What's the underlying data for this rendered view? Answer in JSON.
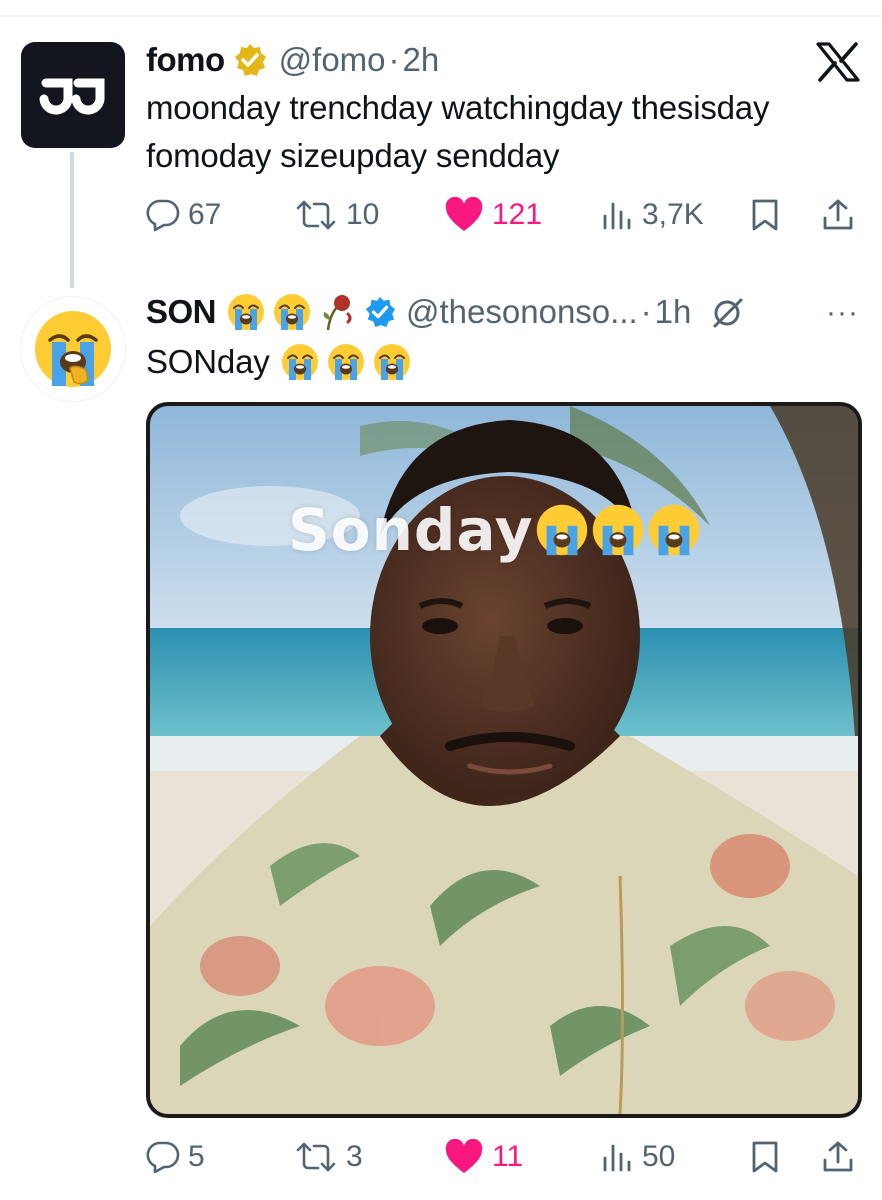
{
  "thread": [
    {
      "name": "fomo",
      "handle": "@fomo",
      "dot": "·",
      "time": "2h",
      "text_line1": "moonday trenchday watchingday thesisday",
      "text_line2": "fomoday sizeupday sendday",
      "replies": "67",
      "reposts": "10",
      "likes": "121",
      "views": "3,7K",
      "verified_color": "#e2b719",
      "avatar_icon": "fomo-logo-icon"
    },
    {
      "name": "SON",
      "handle": "@thesononso...",
      "dot": "·",
      "time": "1h",
      "text": "SONday",
      "more": "···",
      "media_caption": "Sonday",
      "replies": "5",
      "reposts": "3",
      "likes": "11",
      "views": "50",
      "verified_color": "#1d9bf0",
      "avatar_icon": "loudly-crying-face-icon"
    }
  ],
  "colors": {
    "like": "#f91880",
    "secondary": "#536471",
    "primary_text": "#0f1419"
  }
}
